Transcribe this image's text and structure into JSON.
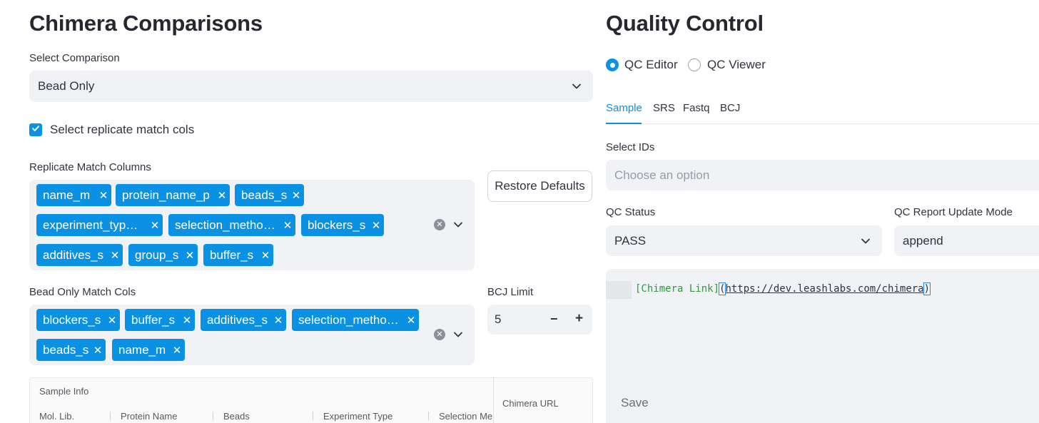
{
  "left": {
    "title": "Chimera Comparisons",
    "select_comparison": {
      "label": "Select Comparison",
      "value": "Bead Only"
    },
    "replicate_checkbox": {
      "label": "Select replicate match cols",
      "checked": true
    },
    "replicate_cols": {
      "label": "Replicate Match Columns",
      "chips": [
        "name_m",
        "protein_name_p",
        "beads_s",
        "experiment_typ…",
        "selection_metho…",
        "blockers_s",
        "additives_s",
        "group_s",
        "buffer_s"
      ]
    },
    "restore_defaults": "Restore Defaults",
    "bead_only_cols": {
      "label": "Bead Only Match Cols",
      "chips": [
        "blockers_s",
        "buffer_s",
        "additives_s",
        "selection_metho…",
        "beads_s",
        "name_m"
      ]
    },
    "bcj_limit": {
      "label": "BCJ Limit",
      "value": "5",
      "minus": "−",
      "plus": "+"
    },
    "table": {
      "group_header": "Sample Info",
      "columns": [
        "Mol. Lib.",
        "Protein Name",
        "Beads",
        "Experiment Type",
        "Selection Me"
      ],
      "extra_column": "Chimera URL"
    }
  },
  "right": {
    "title": "Quality Control",
    "radio": {
      "options": [
        "QC Editor",
        "QC Viewer"
      ],
      "selected": "QC Editor"
    },
    "tabs": [
      "Sample",
      "SRS",
      "Fastq",
      "BCJ"
    ],
    "active_tab": "Sample",
    "select_ids": {
      "label": "Select IDs",
      "placeholder": "Choose an option"
    },
    "qc_status": {
      "label": "QC Status",
      "value": "PASS"
    },
    "qc_report_mode": {
      "label": "QC Report Update Mode",
      "value": "append"
    },
    "editor": {
      "link_text": "[Chimera Link]",
      "link_url": "https://dev.leashlabs.com/chimera",
      "open_paren": "(",
      "close_paren": ")"
    },
    "save": "Save"
  },
  "colors": {
    "accent": "#0b91e3",
    "input_bg": "#f0f2f6",
    "text": "#31333f"
  },
  "icons": [
    "chevron-down-icon",
    "check-icon",
    "close-icon",
    "clear-icon",
    "radio-selected",
    "radio-unselected"
  ]
}
